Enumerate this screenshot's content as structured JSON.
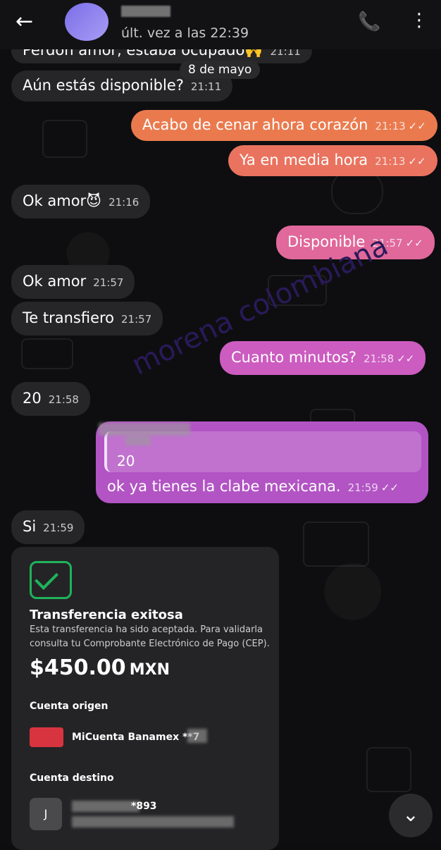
{
  "header": {
    "back_icon": "←",
    "last_seen": "últ. vez a las 22:39",
    "phone_icon": "📞",
    "menu_icon": "⋮"
  },
  "date_pill": "8 de mayo",
  "messages": [
    {
      "text": "Perdón amor, estaba ocupado🙌",
      "time": "21:11",
      "dir": "in"
    },
    {
      "text": "Aún estás disponible?",
      "time": "21:11",
      "dir": "in"
    },
    {
      "text": "Acabo de cenar ahora corazón",
      "time": "21:13",
      "dir": "out"
    },
    {
      "text": "Ya en media hora",
      "time": "21:13",
      "dir": "out"
    },
    {
      "text": "Ok amor😈",
      "time": "21:16",
      "dir": "in"
    },
    {
      "text": "Disponible",
      "time": "21:57",
      "dir": "out"
    },
    {
      "text": "Ok amor",
      "time": "21:57",
      "dir": "in"
    },
    {
      "text": "Te transfiero",
      "time": "21:57",
      "dir": "in"
    },
    {
      "text": "Cuanto minutos?",
      "time": "21:58",
      "dir": "out"
    },
    {
      "text": "20",
      "time": "21:58",
      "dir": "in"
    },
    {
      "text": "ok ya tienes la clabe mexicana.",
      "time": "21:59",
      "dir": "out",
      "reply_text": "20"
    },
    {
      "text": "Si",
      "time": "21:59",
      "dir": "in"
    }
  ],
  "read_receipt": "✓✓",
  "watermark": "morena colombiana",
  "transfer": {
    "title": "Transferencia exitosa",
    "desc1": "Esta transferencia ha sido aceptada. Para validarla",
    "desc2": "consulta tu Comprobante Electrónico de Pago (CEP).",
    "amount": "$450.00",
    "currency": "MXN",
    "origin_label": "Cuenta origen",
    "origin_account": "MiCuenta Banamex **7",
    "dest_label": "Cuenta destino",
    "dest_initial": "J",
    "dest_account": "*893"
  },
  "scroll_icon": "⌄",
  "colors": {
    "orange": "#ea7a4e",
    "pink": "#e0689a",
    "purple": "#b254c4",
    "green": "#1fb35b"
  }
}
